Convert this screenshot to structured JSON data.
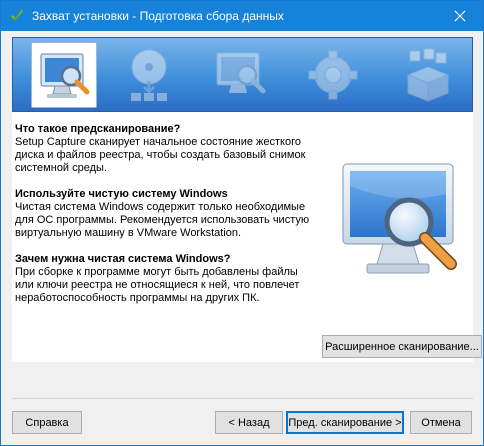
{
  "window": {
    "title": "Захват установки - Подготовка сбора данных",
    "accent_color": "#1683d8"
  },
  "steps": [
    {
      "name": "prescan-icon",
      "active": true
    },
    {
      "name": "install-disc-icon",
      "active": false
    },
    {
      "name": "postscan-icon",
      "active": false
    },
    {
      "name": "settings-gear-icon",
      "active": false
    },
    {
      "name": "package-box-icon",
      "active": false
    }
  ],
  "sections": {
    "prescan": {
      "heading": "Что такое предсканирование?",
      "lines": [
        "Setup Capture сканирует начальное состояние жесткого",
        "диска и файлов реестра, чтобы создать базовый снимок",
        "системной среды."
      ]
    },
    "clean_system": {
      "heading": "Используйте чистую систему Windows",
      "lines": [
        "Чистая система Windows содержит только необходимые",
        "для ОС программы. Рекомендуется использовать чистую",
        "виртуальную машину в VMware Workstation."
      ]
    },
    "why_clean": {
      "heading": "Зачем нужна чистая система Windows?",
      "lines": [
        "При сборке к программе могут быть добавлены файлы",
        "или ключи реестра не относящиеся к ней, что повлечет",
        "неработоспособность программы на других ПК."
      ]
    }
  },
  "buttons": {
    "advanced_scan": "Расширенное сканирование...",
    "help": "Справка",
    "back": "< Назад",
    "prescan": "Пред. сканирование >",
    "cancel": "Отмена"
  }
}
